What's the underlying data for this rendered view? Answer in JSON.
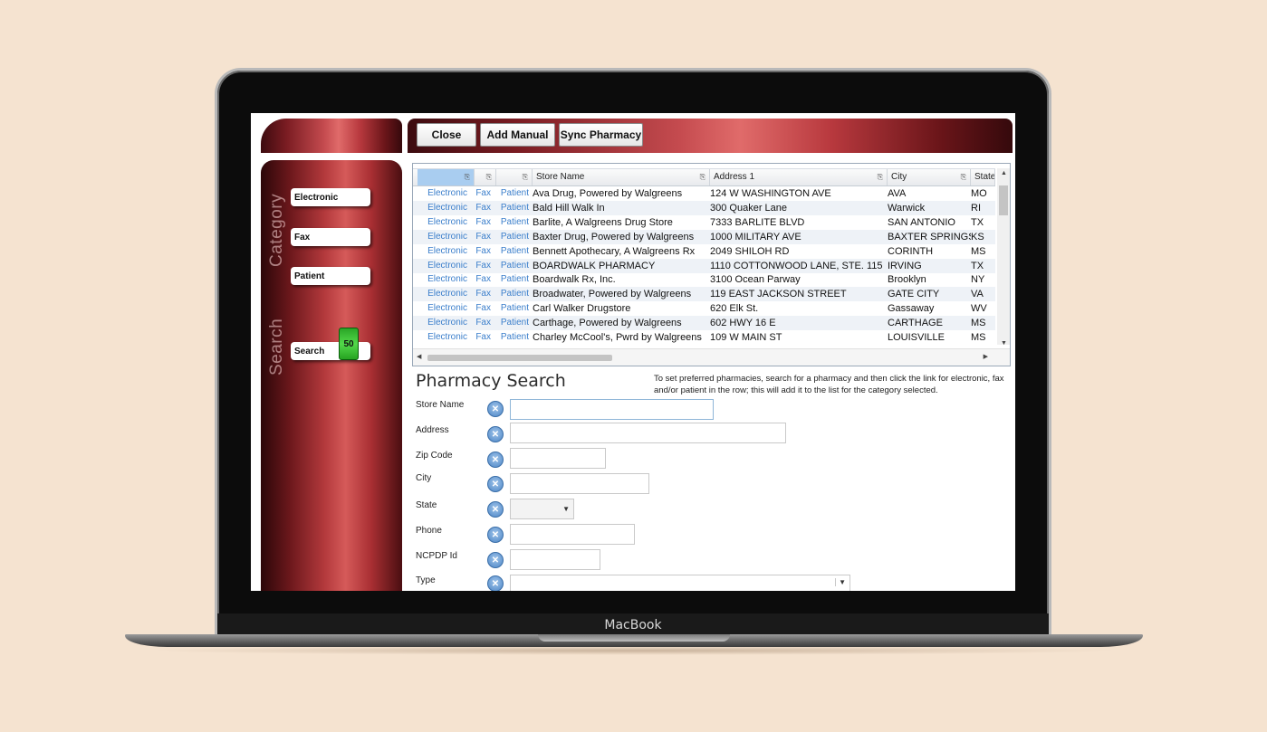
{
  "device": {
    "brand": "MacBook"
  },
  "toolbar": {
    "close": "Close",
    "add_manual": "Add Manual",
    "sync": "Sync Pharmacy"
  },
  "sidebar": {
    "category_label": "Category",
    "search_label": "Search",
    "buttons": {
      "electronic": "Electronic",
      "fax": "Fax",
      "patient": "Patient",
      "search": "Search"
    },
    "search_count": "50"
  },
  "grid": {
    "columns": {
      "store_name": "Store Name",
      "address1": "Address 1",
      "city": "City",
      "state": "State"
    },
    "link_labels": {
      "electronic": "Electronic",
      "fax": "Fax",
      "patient": "Patient"
    },
    "rows": [
      {
        "name": "Ava Drug, Powered by Walgreens",
        "address": "124 W WASHINGTON AVE",
        "city": "AVA",
        "state": "MO"
      },
      {
        "name": "Bald Hill Walk In",
        "address": "300 Quaker Lane",
        "city": "Warwick",
        "state": "RI"
      },
      {
        "name": "Barlite, A Walgreens Drug Store",
        "address": "7333 BARLITE BLVD",
        "city": "SAN ANTONIO",
        "state": "TX"
      },
      {
        "name": "Baxter Drug, Powered by Walgreens",
        "address": "1000 MILITARY AVE",
        "city": "BAXTER SPRINGS",
        "state": "KS"
      },
      {
        "name": "Bennett Apothecary, A Walgreens Rx",
        "address": "2049 SHILOH RD",
        "city": "CORINTH",
        "state": "MS"
      },
      {
        "name": "BOARDWALK PHARMACY",
        "address": "1110 COTTONWOOD LANE, STE. 115",
        "city": "IRVING",
        "state": "TX"
      },
      {
        "name": "Boardwalk Rx, Inc.",
        "address": "3100 Ocean Parway",
        "city": "Brooklyn",
        "state": "NY"
      },
      {
        "name": "Broadwater, Powered by Walgreens",
        "address": "119 EAST JACKSON STREET",
        "city": "GATE CITY",
        "state": "VA"
      },
      {
        "name": "Carl Walker Drugstore",
        "address": "620 Elk St.",
        "city": "Gassaway",
        "state": "WV"
      },
      {
        "name": "Carthage, Powered by Walgreens",
        "address": "602 HWY 16 E",
        "city": "CARTHAGE",
        "state": "MS"
      },
      {
        "name": "Charley McCool's, Pwrd by Walgreens",
        "address": "109 W MAIN ST",
        "city": "LOUISVILLE",
        "state": "MS"
      }
    ]
  },
  "form": {
    "title": "Pharmacy Search",
    "help": "To set preferred pharmacies, search for a pharmacy and then click the link for electronic, fax and/or patient in the row; this will add it to the list for the category selected.",
    "labels": {
      "store_name": "Store Name",
      "address": "Address",
      "zip": "Zip Code",
      "city": "City",
      "state": "State",
      "phone": "Phone",
      "ncpdp": "NCPDP Id",
      "type": "Type"
    },
    "values": {
      "store_name": "",
      "address": "",
      "zip": "",
      "city": "",
      "state": "",
      "phone": "",
      "ncpdp": "",
      "type": ""
    }
  }
}
